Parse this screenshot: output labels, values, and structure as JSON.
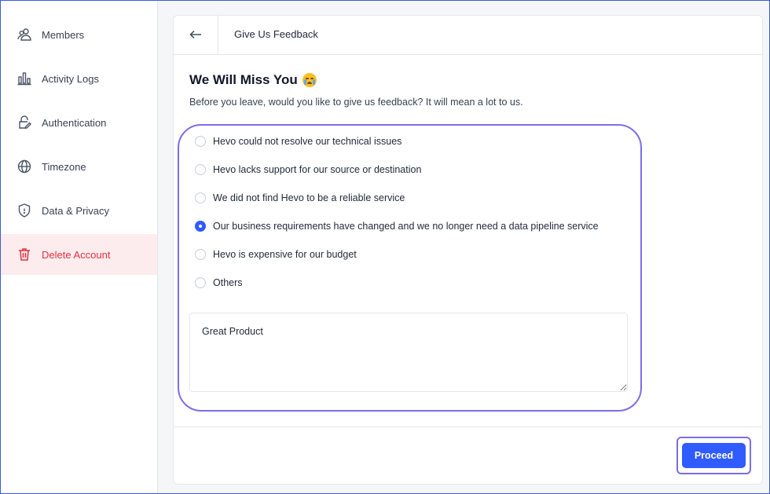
{
  "sidebar": {
    "items": [
      {
        "label": "Members",
        "icon": "members-icon",
        "active": false
      },
      {
        "label": "Activity Logs",
        "icon": "bar-chart-icon",
        "active": false
      },
      {
        "label": "Authentication",
        "icon": "lock-edit-icon",
        "active": false
      },
      {
        "label": "Timezone",
        "icon": "globe-icon",
        "active": false
      },
      {
        "label": "Data & Privacy",
        "icon": "shield-icon",
        "active": false
      },
      {
        "label": "Delete Account",
        "icon": "trash-icon",
        "active": true
      }
    ]
  },
  "header": {
    "back_icon": "arrow-left-icon",
    "title": "Give Us Feedback"
  },
  "content": {
    "heading": "We Will Miss You",
    "heading_emoji": "crying-face-icon",
    "subtitle": "Before you leave, would you like to give us feedback? It will mean a lot to us.",
    "options": [
      {
        "label": "Hevo could not resolve our technical issues",
        "checked": false
      },
      {
        "label": "Hevo lacks support for our source or destination",
        "checked": false
      },
      {
        "label": "We did not find Hevo to be a reliable service",
        "checked": false
      },
      {
        "label": "Our business requirements have changed and we no longer need a data pipeline service",
        "checked": true
      },
      {
        "label": "Hevo is expensive for our budget",
        "checked": false
      },
      {
        "label": "Others",
        "checked": false
      }
    ],
    "feedback_text": "Great Product"
  },
  "footer": {
    "proceed_label": "Proceed"
  },
  "colors": {
    "accent": "#2f5bff",
    "danger": "#e0313f",
    "focus_ring": "#7c6ee6"
  }
}
